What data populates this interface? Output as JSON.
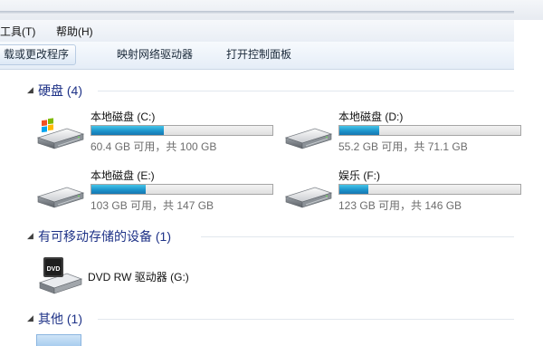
{
  "menu": [
    {
      "label": "工具(T)"
    },
    {
      "label": "帮助(H)"
    }
  ],
  "toolbar": [
    {
      "label": "载或更改程序"
    },
    {
      "label": "映射网络驱动器"
    },
    {
      "label": "打开控制面板"
    }
  ],
  "groups": {
    "hard_drives": {
      "title": "硬盘 (4)"
    },
    "removable": {
      "title": "有可移动存储的设备 (1)"
    },
    "other": {
      "title": "其他 (1)"
    }
  },
  "drives": [
    {
      "name": "本地磁盘 (C:)",
      "space": "60.4 GB 可用，共 100 GB",
      "used_fraction": 0.4,
      "windows_logo": true
    },
    {
      "name": "本地磁盘 (D:)",
      "space": "55.2 GB 可用，共 71.1 GB",
      "used_fraction": 0.22,
      "windows_logo": false
    },
    {
      "name": "本地磁盘 (E:)",
      "space": "103 GB 可用，共 147 GB",
      "used_fraction": 0.3,
      "windows_logo": false
    },
    {
      "name": "娱乐 (F:)",
      "space": "123 GB 可用，共 146 GB",
      "used_fraction": 0.16,
      "windows_logo": false
    }
  ],
  "dvd": {
    "name": "DVD RW 驱动器 (G:)",
    "icon_label": "DVD"
  },
  "colors": {
    "accent": "#1e3287",
    "bar_fill": "#1d95cc"
  }
}
